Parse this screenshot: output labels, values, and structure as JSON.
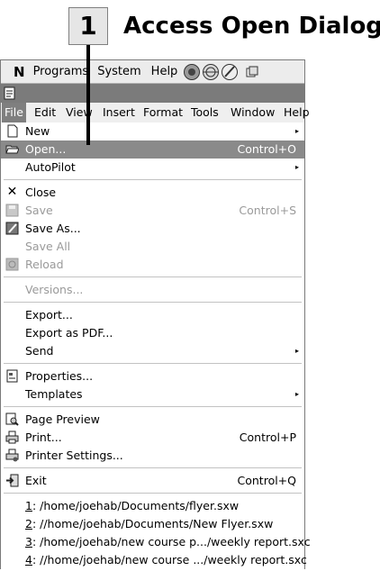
{
  "callout": {
    "number": "1",
    "title": "Access Open Dialog"
  },
  "panel": {
    "logo": "N",
    "programs": "Programs",
    "system": "System",
    "help": "Help"
  },
  "menubar": [
    {
      "label": "File",
      "key": "file"
    },
    {
      "label": "Edit",
      "key": "edit"
    },
    {
      "label": "View",
      "key": "view"
    },
    {
      "label": "Insert",
      "key": "insert"
    },
    {
      "label": "Format",
      "key": "format"
    },
    {
      "label": "Tools",
      "key": "tools"
    },
    {
      "label": "Window",
      "key": "window"
    },
    {
      "label": "Help",
      "key": "help"
    }
  ],
  "file_menu": {
    "new": {
      "label": "New"
    },
    "open": {
      "label": "Open...",
      "shortcut": "Control+O"
    },
    "autopilot": {
      "label": "AutoPilot"
    },
    "close": {
      "label": "Close"
    },
    "save": {
      "label": "Save",
      "shortcut": "Control+S"
    },
    "save_as": {
      "label": "Save As..."
    },
    "save_all": {
      "label": "Save All"
    },
    "reload": {
      "label": "Reload"
    },
    "versions": {
      "label": "Versions..."
    },
    "export": {
      "label": "Export..."
    },
    "export_pdf": {
      "label": "Export as PDF..."
    },
    "send": {
      "label": "Send"
    },
    "properties": {
      "label": "Properties..."
    },
    "templates": {
      "label": "Templates"
    },
    "page_preview": {
      "label": "Page Preview"
    },
    "print": {
      "label": "Print...",
      "shortcut": "Control+P"
    },
    "printer_settings": {
      "label": "Printer Settings..."
    },
    "exit": {
      "label": "Exit",
      "shortcut": "Control+Q"
    },
    "recent": [
      {
        "num": "1",
        "path": ": /home/joehab/Documents/flyer.sxw"
      },
      {
        "num": "2",
        "path": ": //home/joehab/Documents/New Flyer.sxw"
      },
      {
        "num": "3",
        "path": ": /home/joehab/new course p.../weekly report.sxc"
      },
      {
        "num": "4",
        "path": ": //home/joehab/new course .../weekly report.sxc"
      }
    ]
  }
}
